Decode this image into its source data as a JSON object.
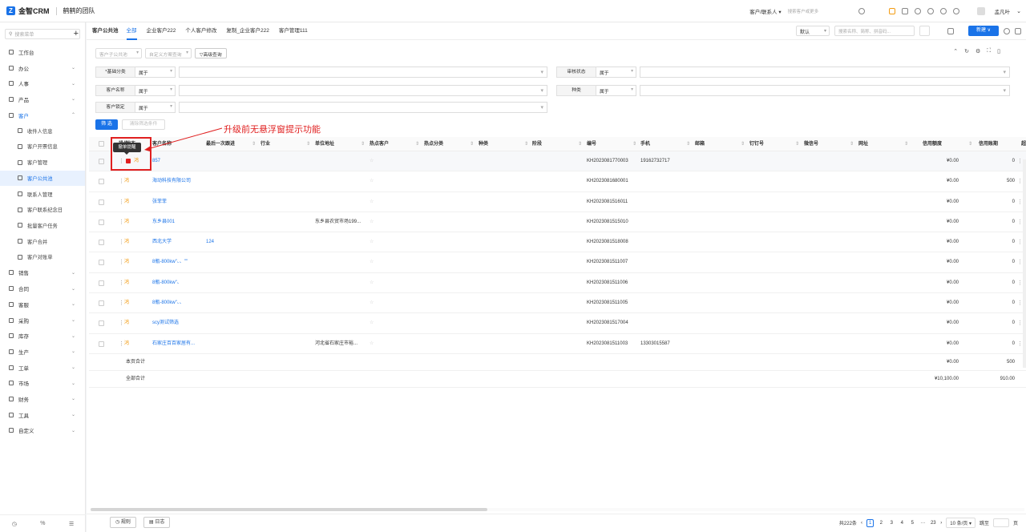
{
  "app": {
    "logo_text": "金智CRM",
    "team": "鹤鹤的团队"
  },
  "topbar": {
    "scope": "客户/联系人 ▾",
    "search_placeholder": "搜索客户或更多",
    "user": "孟凡叶"
  },
  "sidebar": {
    "search_placeholder": "搜索菜单",
    "plus": "+",
    "items": [
      {
        "label": "工作台",
        "type": "top"
      },
      {
        "label": "办公",
        "type": "top",
        "chev": "⌄"
      },
      {
        "label": "人事",
        "type": "top",
        "chev": "⌄"
      },
      {
        "label": "产品",
        "type": "top",
        "chev": "⌄"
      },
      {
        "label": "客户",
        "type": "top",
        "chev": "⌃",
        "open": true
      },
      {
        "label": "收件人信息",
        "type": "sub"
      },
      {
        "label": "客户开票信息",
        "type": "sub"
      },
      {
        "label": "客户管理",
        "type": "sub"
      },
      {
        "label": "客户公共池",
        "type": "sub",
        "active": true
      },
      {
        "label": "联系人管理",
        "type": "sub"
      },
      {
        "label": "客户联系纪念日",
        "type": "sub"
      },
      {
        "label": "批量客户任务",
        "type": "sub"
      },
      {
        "label": "客户合并",
        "type": "sub"
      },
      {
        "label": "客户对账单",
        "type": "sub"
      },
      {
        "label": "销售",
        "type": "top",
        "chev": "⌄"
      },
      {
        "label": "合同",
        "type": "top",
        "chev": "⌄"
      },
      {
        "label": "客服",
        "type": "top",
        "chev": "⌄"
      },
      {
        "label": "采购",
        "type": "top",
        "chev": "⌄"
      },
      {
        "label": "库存",
        "type": "top",
        "chev": "⌄"
      },
      {
        "label": "生产",
        "type": "top",
        "chev": "⌄"
      },
      {
        "label": "工单",
        "type": "top",
        "chev": "⌄"
      },
      {
        "label": "市场",
        "type": "top",
        "chev": "⌄"
      },
      {
        "label": "财务",
        "type": "top",
        "chev": "⌄"
      },
      {
        "label": "工具",
        "type": "top",
        "chev": "⌄"
      },
      {
        "label": "自定义",
        "type": "top",
        "chev": "⌄"
      }
    ],
    "bottom": [
      "◷",
      "%",
      "☰"
    ]
  },
  "tabs": {
    "title": "客户公共池",
    "items": [
      "全部",
      "企业客户222",
      "个人客户修改",
      "复制_企业客户222",
      "客户管理111"
    ],
    "active": 0
  },
  "toolbar": {
    "view_select": "默认",
    "search_placeholder": "搜索名称、简称、拼音码...",
    "new_button": "新建 ∨"
  },
  "filters": {
    "pool_select": "客户子公共池",
    "scheme_select": "自定义方案查询",
    "advanced": "▽高级查询",
    "conditions": [
      {
        "label": "*基础分类",
        "op": "属于"
      },
      {
        "label": "审核状态",
        "op": "属于"
      },
      {
        "label": "客户名称",
        "op": "属于"
      },
      {
        "label": "种类",
        "op": "属于"
      },
      {
        "label": "客户锁定",
        "op": "属于"
      }
    ],
    "filter_button": "筛 选",
    "clear_button": "清除筛选条件"
  },
  "annotation": {
    "text": "升级前无悬浮窗提示功能",
    "tooltip": "撤单提醒"
  },
  "table": {
    "headers": [
      "操作",
      "状态",
      "客户名称",
      "最后一次跟进",
      "行业",
      "单位地址",
      "热点客户",
      "热点分类",
      "种类",
      "阶段",
      "编号",
      "手机",
      "邮箱",
      "钉钉号",
      "微信号",
      "网址",
      "信用额度",
      "信用账期",
      "超"
    ],
    "rows": [
      {
        "name": "857",
        "addr": "",
        "code": "KH2023081770003",
        "phone": "19162732717",
        "credit": "¥0.00",
        "term": "0",
        "extra": ""
      },
      {
        "name": "海动科技有限公司",
        "addr": "",
        "code": "KH2023081680001",
        "phone": "",
        "credit": "¥0.00",
        "term": "500",
        "extra": ""
      },
      {
        "name": "张菲菲",
        "addr": "",
        "code": "KH2023081516011",
        "phone": "",
        "credit": "¥0.00",
        "term": "0",
        "extra": ""
      },
      {
        "name": "东乡县001",
        "addr": "东乡县农贸市场199...",
        "code": "KH2023081515010",
        "phone": "",
        "credit": "¥0.00",
        "term": "0",
        "extra": ""
      },
      {
        "name": "西北大学",
        "addr": "",
        "code": "KH2023081518008",
        "phone": "",
        "credit": "¥0.00",
        "term": "0",
        "extra": "124"
      },
      {
        "name": "8瓶-800kw\"、、\"\"",
        "addr": "",
        "code": "KH2023081511007",
        "phone": "",
        "credit": "¥0.00",
        "term": "0",
        "extra": ""
      },
      {
        "name": "8瓶-800kw\"、",
        "addr": "",
        "code": "KH2023081511006",
        "phone": "",
        "credit": "¥0.00",
        "term": "0",
        "extra": ""
      },
      {
        "name": "8瓶-800kw\"、、",
        "addr": "",
        "code": "KH2023081511005",
        "phone": "",
        "credit": "¥0.00",
        "term": "0",
        "extra": ""
      },
      {
        "name": "scy测试筛选",
        "addr": "",
        "code": "KH2023081517004",
        "phone": "",
        "credit": "¥0.00",
        "term": "0",
        "extra": ""
      },
      {
        "name": "石家庄百百家居有...",
        "addr": "河北省石家庄市裕...",
        "code": "KH2023081511003",
        "phone": "13303015587",
        "credit": "¥0.00",
        "term": "0",
        "extra": ""
      }
    ],
    "page_total": {
      "label": "本页合计",
      "credit": "¥0.00",
      "term": "500"
    },
    "all_total": {
      "label": "全部合计",
      "credit": "¥10,100.00",
      "term": "910.00"
    }
  },
  "footer": {
    "rules_button": "◷ 规则",
    "log_button": "▤ 日志",
    "total": "共222条",
    "pages": [
      "1",
      "2",
      "3",
      "4",
      "5",
      "···",
      "23"
    ],
    "page_size": "10 条/页 ▾",
    "jump_label": "跳至",
    "page_unit": "页",
    "prev": "‹",
    "next": "›"
  }
}
